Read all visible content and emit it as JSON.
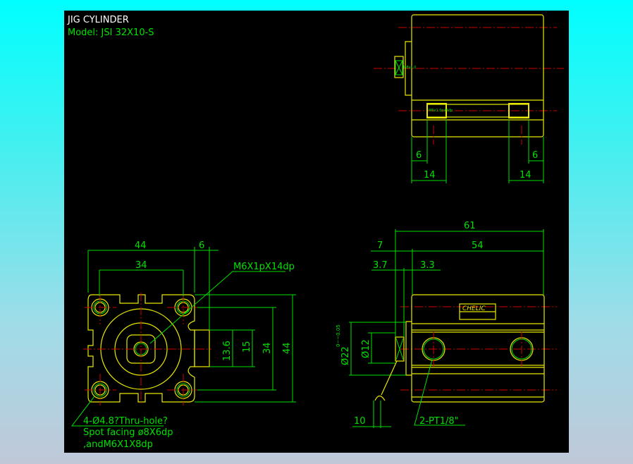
{
  "title": "JIG CYLINDER",
  "model": "Model: JSI 32X10-S",
  "colors": {
    "outline": "#e8e800",
    "dimension": "#00e000",
    "centerline": "#d00000",
    "canvas": "#000000"
  },
  "top_view": {
    "dims": [
      "6",
      "6",
      "14",
      "14"
    ],
    "note_rod": "M8x1.0",
    "note_thread": "M6x1.0px8dp."
  },
  "front_view": {
    "dims": {
      "width": "44",
      "step": "6",
      "hole_pitch": "34",
      "port_a": "13.6",
      "port_b": "15",
      "pitch_v": "34",
      "height": "44"
    },
    "thread_note": "M6X1pX14dp",
    "hole_note": [
      "4-Ø4.8?Thru-hole?",
      "Spot facing ø8X6dp",
      ",andM6X1X8dp"
    ]
  },
  "side_view": {
    "dims": {
      "total": "61",
      "rod": "7",
      "body": "54",
      "a": "3.7",
      "b": "3.3",
      "boss": "Ø22",
      "boss_tol": "0−−0.05",
      "rod_dia": "Ø12",
      "wrench": "10"
    },
    "port_note": "2-PT1/8\"",
    "brand_label": "CHELIC"
  }
}
